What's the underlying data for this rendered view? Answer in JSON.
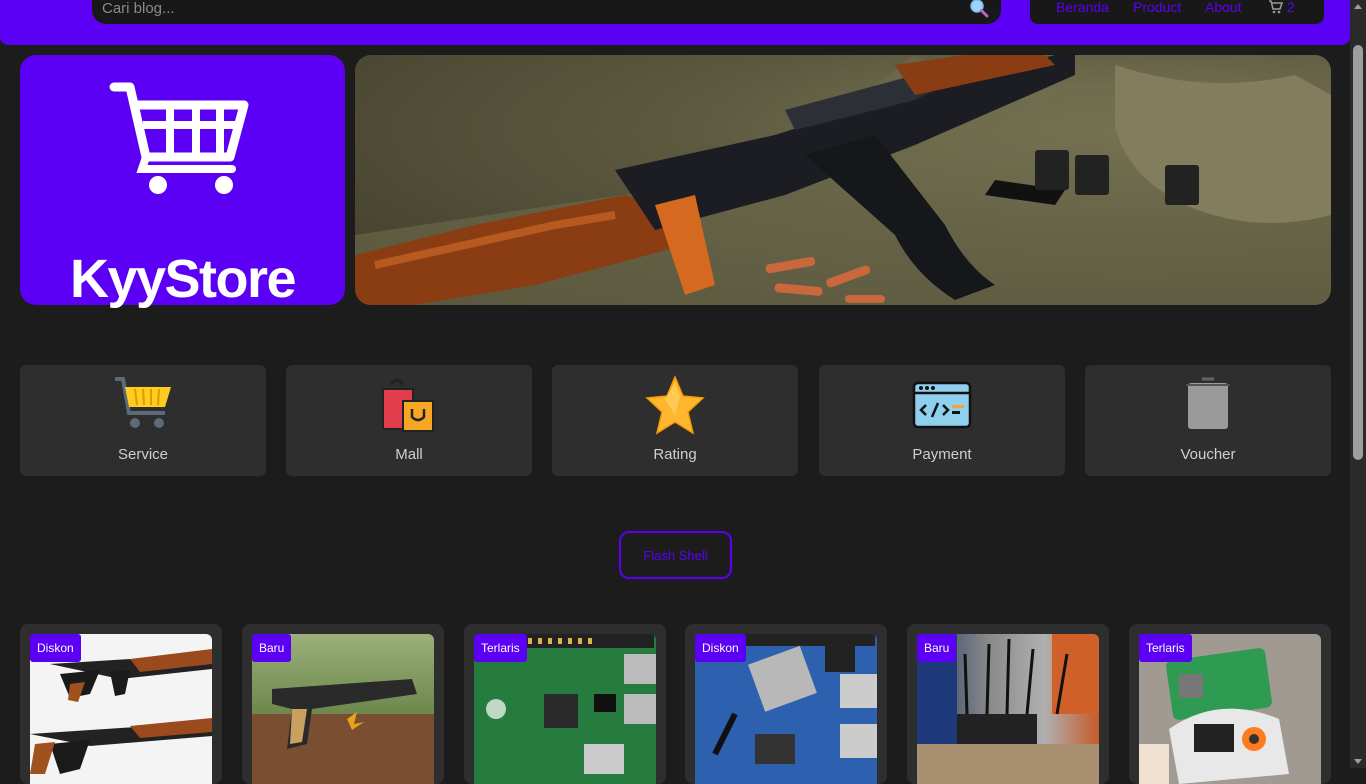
{
  "header": {
    "search_placeholder": "Cari blog...",
    "nav": [
      {
        "label": "Beranda"
      },
      {
        "label": "Product"
      },
      {
        "label": "About"
      }
    ],
    "cart_count": "2"
  },
  "brand": {
    "logo_text": "KyyStore",
    "banner_icon": "rifle-photo"
  },
  "categories": [
    {
      "label": "Service",
      "icon": "shopping-cart-icon"
    },
    {
      "label": "Mall",
      "icon": "shopping-bags-icon"
    },
    {
      "label": "Rating",
      "icon": "star-icon"
    },
    {
      "label": "Payment",
      "icon": "code-window-icon"
    },
    {
      "label": "Voucher",
      "icon": "voucher-icon"
    }
  ],
  "flash_button": "Flash Shell",
  "products": [
    {
      "tag": "Diskon",
      "image": "ak-rifles-photo"
    },
    {
      "tag": "Baru",
      "image": "pistol-carbine-photo"
    },
    {
      "tag": "Terlaris",
      "image": "raspberry-pi-photo"
    },
    {
      "tag": "Diskon",
      "image": "single-board-computer-photo"
    },
    {
      "tag": "Baru",
      "image": "router-antennas-photo"
    },
    {
      "tag": "Terlaris",
      "image": "flipper-device-photo"
    }
  ],
  "colors": {
    "accent": "#5b00f4",
    "background": "#1c1c1c",
    "card": "#2e2e2e"
  }
}
